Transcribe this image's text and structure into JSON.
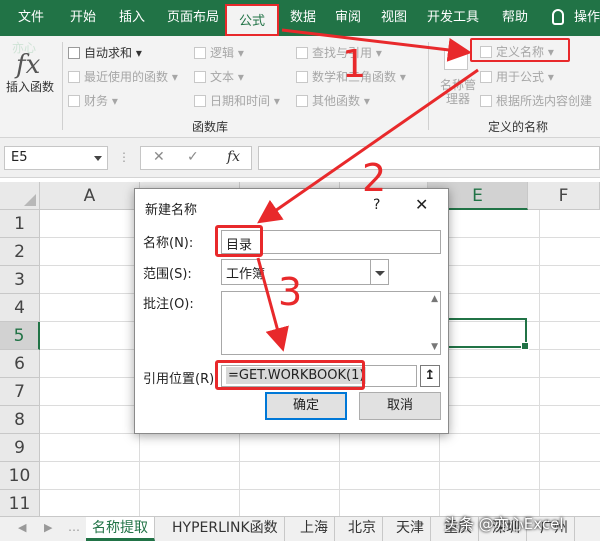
{
  "ribbon_tabs": [
    {
      "label": "文件"
    },
    {
      "label": "开始"
    },
    {
      "label": "插入"
    },
    {
      "label": "页面布局"
    },
    {
      "label": "公式",
      "active": true
    },
    {
      "label": "数据"
    },
    {
      "label": "审阅"
    },
    {
      "label": "视图"
    },
    {
      "label": "开发工具"
    },
    {
      "label": "帮助"
    },
    {
      "label": "操作"
    }
  ],
  "ribbon": {
    "insert_function": "插入函数",
    "autosum": "自动求和",
    "recently_used": "最近使用的函数",
    "financial": "财务",
    "logical": "逻辑",
    "text": "文本",
    "date_time": "日期和时间",
    "lookup_ref": "查找与引用",
    "math_trig": "数学和三角函数",
    "other_functions": "其他函数",
    "function_library": "函数库",
    "define_name": "定义名称",
    "use_in_formula": "用于公式",
    "name_manager": "名称管理器",
    "create_from_selection": "根据所选内容创建",
    "defined_names": "定义的名称",
    "watermark": "亦心"
  },
  "formula_bar": {
    "name_box": "E5",
    "cancel": "✕",
    "enter": "✓",
    "fx": "fx",
    "value": ""
  },
  "grid": {
    "columns": [
      "A",
      "B",
      "C",
      "D",
      "E",
      "F"
    ],
    "rows": [
      "1",
      "2",
      "3",
      "4",
      "5",
      "6",
      "7",
      "8",
      "9",
      "10",
      "11"
    ],
    "active_cell": "E5"
  },
  "dialog": {
    "title": "新建名称",
    "help": "?",
    "close": "✕",
    "name_label": "名称(N):",
    "name_value": "目录",
    "scope_label": "范围(S):",
    "scope_value": "工作簿",
    "comment_label": "批注(O):",
    "comment_value": "",
    "refers_label": "引用位置(R):",
    "refers_value": "=GET.WORKBOOK(1)",
    "collapse": "↥",
    "ok": "确定",
    "cancel": "取消"
  },
  "sheets": [
    "名称提取",
    "HYPERLINK函数",
    "上海",
    "北京",
    "天津",
    "重庆",
    "深圳",
    "广州"
  ],
  "active_sheet": "名称提取",
  "annotations": {
    "step1": "1",
    "step2": "2",
    "step3": "3",
    "watermark": "头条 @亦心Excel"
  },
  "colors": {
    "excel_green": "#217346",
    "annotation_red": "#e8292b",
    "ok_button_border": "#0078d7"
  }
}
